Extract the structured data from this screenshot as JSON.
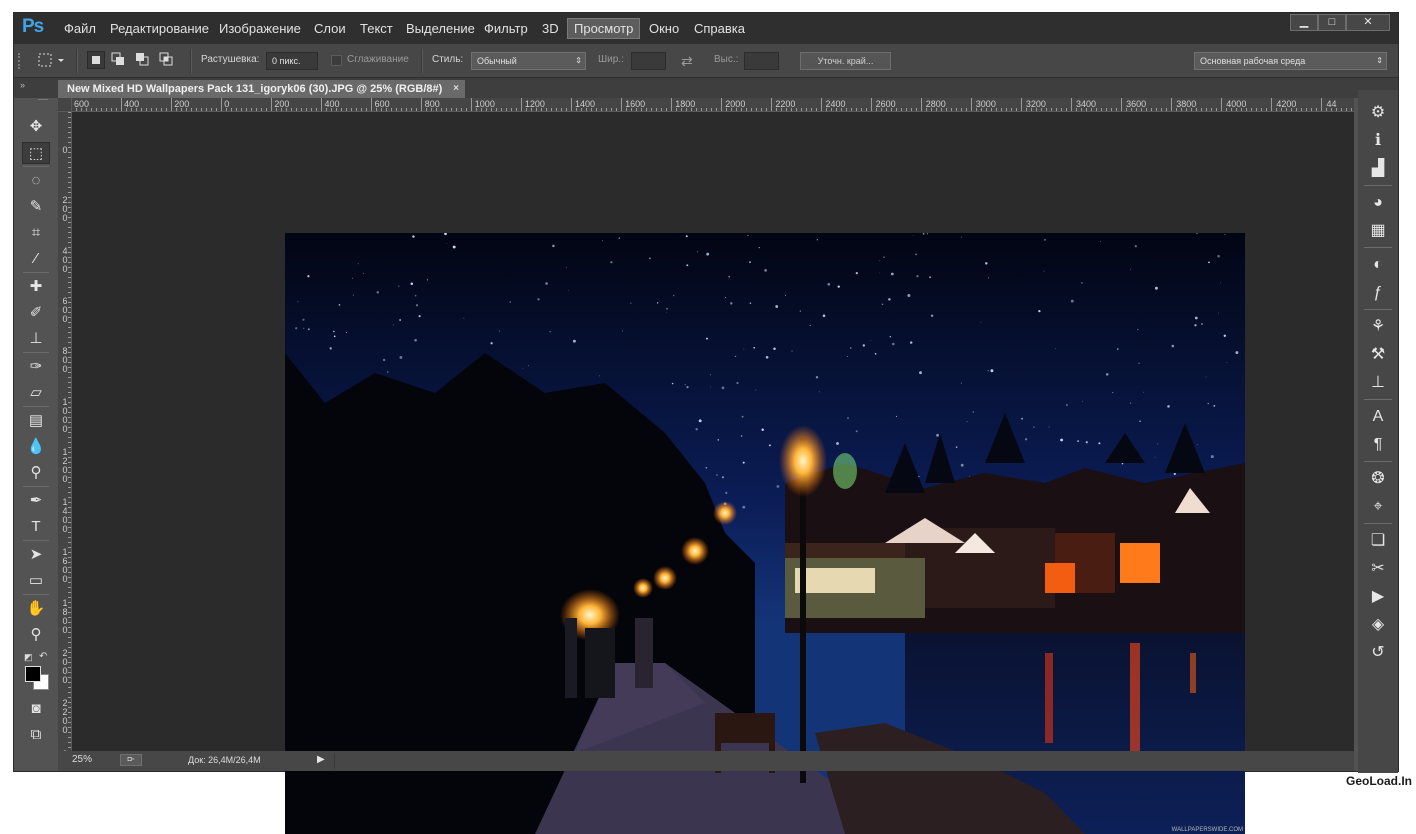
{
  "app": {
    "logo": "Ps",
    "menu": [
      "Файл",
      "Редактирование",
      "Изображение",
      "Слои",
      "Текст",
      "Выделение",
      "Фильтр",
      "3D",
      "Просмотр",
      "Окно",
      "Справка"
    ],
    "active_menu": "Просмотр",
    "window_controls": {
      "minimize": "▁",
      "maximize": "□",
      "close": "✕"
    }
  },
  "options_bar": {
    "feather_label": "Растушевка:",
    "feather_value": "0 пикс.",
    "antialias_label": "Сглаживание",
    "style_label": "Стиль:",
    "style_value": "Обычный",
    "width_label": "Шир.:",
    "height_label": "Выс.:",
    "refine_edge": "Уточн. край...",
    "workspace": "Основная рабочая среда"
  },
  "document": {
    "tab_title": "New Mixed HD Wallpapers Pack 131_igoryk06 (30).JPG @ 25% (RGB/8#)",
    "tab_close": "×",
    "image_watermark": "WALLPAPERSWIDE.COM"
  },
  "ruler": {
    "horizontal": [
      "600",
      "400",
      "200",
      "0",
      "200",
      "400",
      "600",
      "800",
      "1000",
      "1200",
      "1400",
      "1600",
      "1800",
      "2000",
      "2200",
      "2400",
      "2600",
      "2800",
      "3000",
      "3200",
      "3400",
      "3600",
      "3800",
      "4000",
      "4200",
      "44"
    ],
    "vertical": [
      "0",
      "200",
      "400",
      "600",
      "800",
      "1000",
      "1200",
      "1400",
      "1600",
      "1800",
      "2000",
      "2200",
      "2"
    ]
  },
  "status_bar": {
    "zoom": "25%",
    "doc_info": "Док: 26,4M/26,4M"
  },
  "tools": [
    {
      "name": "move-tool-icon",
      "glyph": "✥"
    },
    {
      "name": "marquee-tool-icon",
      "glyph": "⬚"
    },
    {
      "name": "lasso-tool-icon",
      "glyph": "◌"
    },
    {
      "name": "quick-selection-tool-icon",
      "glyph": "✎"
    },
    {
      "name": "crop-tool-icon",
      "glyph": "⌗"
    },
    {
      "name": "eyedropper-tool-icon",
      "glyph": "⁄"
    },
    {
      "name": "healing-brush-tool-icon",
      "glyph": "✚"
    },
    {
      "name": "brush-tool-icon",
      "glyph": "✐"
    },
    {
      "name": "clone-stamp-tool-icon",
      "glyph": "⊥"
    },
    {
      "name": "history-brush-tool-icon",
      "glyph": "✑"
    },
    {
      "name": "eraser-tool-icon",
      "glyph": "▱"
    },
    {
      "name": "gradient-tool-icon",
      "glyph": "▤"
    },
    {
      "name": "blur-tool-icon",
      "glyph": "💧"
    },
    {
      "name": "dodge-tool-icon",
      "glyph": "⚲"
    },
    {
      "name": "pen-tool-icon",
      "glyph": "✒"
    },
    {
      "name": "type-tool-icon",
      "glyph": "T"
    },
    {
      "name": "path-selection-tool-icon",
      "glyph": "➤"
    },
    {
      "name": "rectangle-tool-icon",
      "glyph": "▭"
    },
    {
      "name": "hand-tool-icon",
      "glyph": "✋"
    },
    {
      "name": "zoom-tool-icon",
      "glyph": "⚲"
    }
  ],
  "dock_icons": [
    {
      "name": "navigator-icon",
      "glyph": "⚙"
    },
    {
      "name": "info-icon",
      "glyph": "ℹ"
    },
    {
      "name": "histogram-icon",
      "glyph": "▟"
    },
    {
      "name": "color-icon",
      "glyph": "◕"
    },
    {
      "name": "swatches-icon",
      "glyph": "▦"
    },
    {
      "name": "adjustments-icon",
      "glyph": "◐"
    },
    {
      "name": "styles-icon",
      "glyph": "ƒ"
    },
    {
      "name": "brush-presets-icon",
      "glyph": "⚘"
    },
    {
      "name": "tool-presets-icon",
      "glyph": "⚒"
    },
    {
      "name": "clone-source-icon",
      "glyph": "⊥"
    },
    {
      "name": "character-icon",
      "glyph": "A"
    },
    {
      "name": "paragraph-icon",
      "glyph": "¶"
    },
    {
      "name": "channels-icon",
      "glyph": "❂"
    },
    {
      "name": "paths-icon",
      "glyph": "⌖"
    },
    {
      "name": "layer-comps-icon",
      "glyph": "❏"
    },
    {
      "name": "notes-icon",
      "glyph": "✂"
    },
    {
      "name": "actions-icon",
      "glyph": "▶"
    },
    {
      "name": "layers-icon",
      "glyph": "◈"
    },
    {
      "name": "history-icon",
      "glyph": "↺"
    }
  ],
  "watermark": "GeoLoad.In"
}
